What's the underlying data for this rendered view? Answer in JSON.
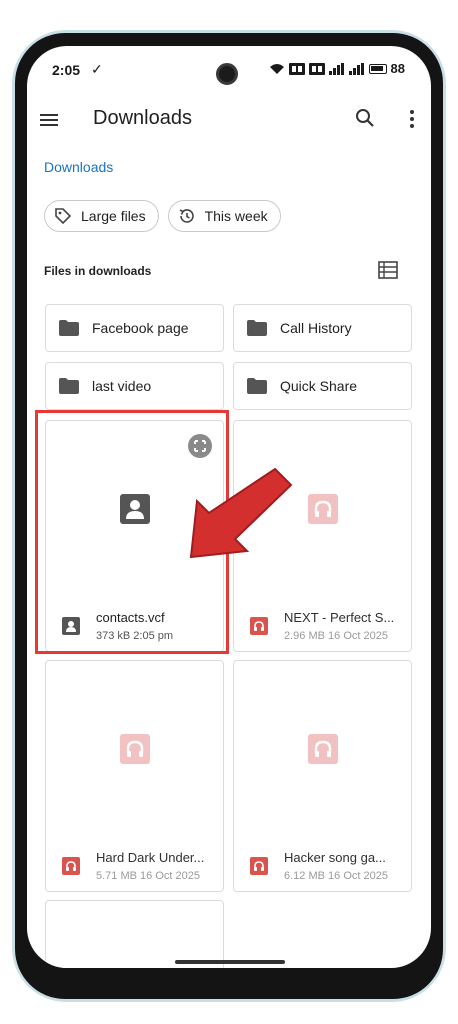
{
  "status_bar": {
    "time": "2:05",
    "check": "✓",
    "battery": "88"
  },
  "app_bar": {
    "title": "Downloads",
    "menu_icon": "hamburger-menu-icon",
    "search_icon": "search-icon",
    "more_icon": "more-vert-icon"
  },
  "breadcrumb": "Downloads",
  "chips": [
    {
      "label": "Large files",
      "icon": "tag-icon"
    },
    {
      "label": "This week",
      "icon": "history-icon"
    }
  ],
  "section_label": "Files in downloads",
  "folders": [
    {
      "name": "Facebook page"
    },
    {
      "name": "Call History"
    },
    {
      "name": "last video"
    },
    {
      "name": "Quick Share"
    }
  ],
  "files": [
    {
      "name": "contacts.vcf",
      "size": "373 kB",
      "time": "2:05 pm",
      "meta": "373 kB 2:05 pm",
      "type": "contact",
      "highlighted": true
    },
    {
      "name": "NEXT - Perfect S...",
      "size": "2.96 MB",
      "time": "16 Oct 2025",
      "meta": "2.96 MB 16 Oct 2025",
      "type": "audio"
    },
    {
      "name": "Hard Dark Under...",
      "size": "5.71 MB",
      "time": "16 Oct 2025",
      "meta": "5.71 MB 16 Oct 2025",
      "type": "audio"
    },
    {
      "name": "Hacker song  ga...",
      "size": "6.12 MB",
      "time": "16 Oct 2025",
      "meta": "6.12 MB 16 Oct 2025",
      "type": "audio"
    }
  ],
  "colors": {
    "accent": "#1a73c8",
    "highlight": "#e53935",
    "audio_icon": "#d9534f",
    "contact_icon": "#555555"
  }
}
